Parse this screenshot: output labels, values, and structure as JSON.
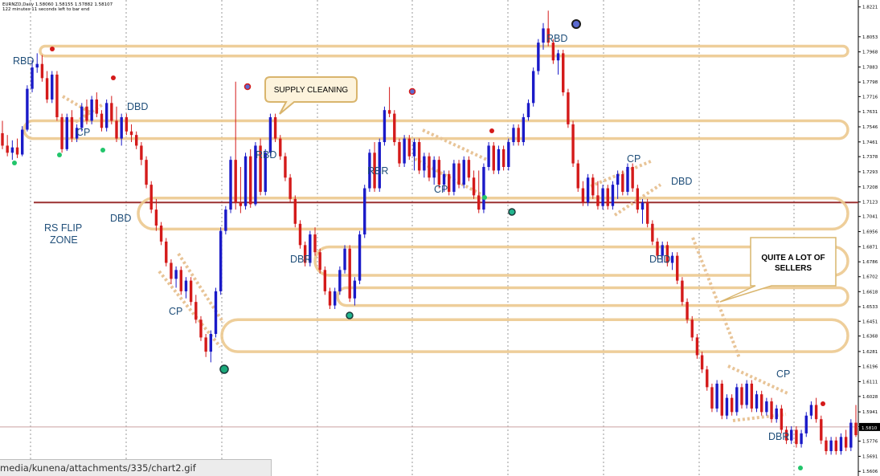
{
  "chart_data": {
    "type": "candlestick",
    "symbol_line": "EURNZD,Daily  1.58060 1.58155 1.57882 1.58107",
    "timer_line": "122 minutes 11 seconds left to bar end",
    "current_price_label": "1.5810",
    "y_ticks": [
      "1.8221",
      "1.8053",
      "1.7968",
      "1.7883",
      "1.7798",
      "1.7716",
      "1.7631",
      "1.7546",
      "1.7461",
      "1.7378",
      "1.7293",
      "1.7208",
      "1.7123",
      "1.7041",
      "1.6956",
      "1.6871",
      "1.6786",
      "1.6702",
      "1.6618",
      "1.6533",
      "1.6451",
      "1.6368",
      "1.6281",
      "1.6196",
      "1.6111",
      "1.6028",
      "1.5941",
      "1.5858",
      "1.5776",
      "1.5691",
      "1.5606"
    ],
    "ylim": [
      1.558,
      1.826
    ],
    "candles": [
      {
        "o": 1.751,
        "h": 1.758,
        "l": 1.742,
        "c": 1.744
      },
      {
        "o": 1.744,
        "h": 1.75,
        "l": 1.738,
        "c": 1.74
      },
      {
        "o": 1.74,
        "h": 1.747,
        "l": 1.736,
        "c": 1.743
      },
      {
        "o": 1.743,
        "h": 1.748,
        "l": 1.737,
        "c": 1.739
      },
      {
        "o": 1.739,
        "h": 1.755,
        "l": 1.738,
        "c": 1.753
      },
      {
        "o": 1.753,
        "h": 1.778,
        "l": 1.752,
        "c": 1.776
      },
      {
        "o": 1.776,
        "h": 1.792,
        "l": 1.774,
        "c": 1.788
      },
      {
        "o": 1.788,
        "h": 1.796,
        "l": 1.785,
        "c": 1.79
      },
      {
        "o": 1.79,
        "h": 1.795,
        "l": 1.78,
        "c": 1.782
      },
      {
        "o": 1.782,
        "h": 1.786,
        "l": 1.768,
        "c": 1.77
      },
      {
        "o": 1.77,
        "h": 1.786,
        "l": 1.768,
        "c": 1.784
      },
      {
        "o": 1.784,
        "h": 1.786,
        "l": 1.758,
        "c": 1.76
      },
      {
        "o": 1.76,
        "h": 1.762,
        "l": 1.74,
        "c": 1.742
      },
      {
        "o": 1.742,
        "h": 1.762,
        "l": 1.741,
        "c": 1.76
      },
      {
        "o": 1.76,
        "h": 1.764,
        "l": 1.746,
        "c": 1.748
      },
      {
        "o": 1.748,
        "h": 1.756,
        "l": 1.746,
        "c": 1.754
      },
      {
        "o": 1.754,
        "h": 1.768,
        "l": 1.752,
        "c": 1.766
      },
      {
        "o": 1.766,
        "h": 1.77,
        "l": 1.756,
        "c": 1.758
      },
      {
        "o": 1.758,
        "h": 1.772,
        "l": 1.756,
        "c": 1.77
      },
      {
        "o": 1.77,
        "h": 1.774,
        "l": 1.76,
        "c": 1.762
      },
      {
        "o": 1.762,
        "h": 1.764,
        "l": 1.752,
        "c": 1.754
      },
      {
        "o": 1.754,
        "h": 1.77,
        "l": 1.752,
        "c": 1.768
      },
      {
        "o": 1.768,
        "h": 1.772,
        "l": 1.756,
        "c": 1.758
      },
      {
        "o": 1.758,
        "h": 1.766,
        "l": 1.746,
        "c": 1.748
      },
      {
        "o": 1.748,
        "h": 1.762,
        "l": 1.744,
        "c": 1.76
      },
      {
        "o": 1.76,
        "h": 1.762,
        "l": 1.75,
        "c": 1.752
      },
      {
        "o": 1.752,
        "h": 1.756,
        "l": 1.746,
        "c": 1.75
      },
      {
        "o": 1.75,
        "h": 1.752,
        "l": 1.742,
        "c": 1.744
      },
      {
        "o": 1.744,
        "h": 1.746,
        "l": 1.733,
        "c": 1.736
      },
      {
        "o": 1.736,
        "h": 1.738,
        "l": 1.72,
        "c": 1.722
      },
      {
        "o": 1.722,
        "h": 1.724,
        "l": 1.706,
        "c": 1.708
      },
      {
        "o": 1.708,
        "h": 1.714,
        "l": 1.696,
        "c": 1.699
      },
      {
        "o": 1.699,
        "h": 1.701,
        "l": 1.688,
        "c": 1.69
      },
      {
        "o": 1.69,
        "h": 1.692,
        "l": 1.676,
        "c": 1.678
      },
      {
        "o": 1.678,
        "h": 1.68,
        "l": 1.666,
        "c": 1.669
      },
      {
        "o": 1.669,
        "h": 1.676,
        "l": 1.664,
        "c": 1.674
      },
      {
        "o": 1.674,
        "h": 1.676,
        "l": 1.66,
        "c": 1.662
      },
      {
        "o": 1.662,
        "h": 1.67,
        "l": 1.658,
        "c": 1.668
      },
      {
        "o": 1.668,
        "h": 1.67,
        "l": 1.654,
        "c": 1.656
      },
      {
        "o": 1.656,
        "h": 1.66,
        "l": 1.644,
        "c": 1.646
      },
      {
        "o": 1.646,
        "h": 1.648,
        "l": 1.634,
        "c": 1.636
      },
      {
        "o": 1.636,
        "h": 1.638,
        "l": 1.625,
        "c": 1.628
      },
      {
        "o": 1.628,
        "h": 1.64,
        "l": 1.622,
        "c": 1.638
      },
      {
        "o": 1.638,
        "h": 1.664,
        "l": 1.636,
        "c": 1.662
      },
      {
        "o": 1.662,
        "h": 1.698,
        "l": 1.66,
        "c": 1.696
      },
      {
        "o": 1.696,
        "h": 1.71,
        "l": 1.694,
        "c": 1.708
      },
      {
        "o": 1.708,
        "h": 1.738,
        "l": 1.706,
        "c": 1.736
      },
      {
        "o": 1.736,
        "h": 1.78,
        "l": 1.708,
        "c": 1.712
      },
      {
        "o": 1.712,
        "h": 1.732,
        "l": 1.706,
        "c": 1.71
      },
      {
        "o": 1.71,
        "h": 1.74,
        "l": 1.708,
        "c": 1.738
      },
      {
        "o": 1.738,
        "h": 1.742,
        "l": 1.709,
        "c": 1.711
      },
      {
        "o": 1.711,
        "h": 1.746,
        "l": 1.71,
        "c": 1.744
      },
      {
        "o": 1.744,
        "h": 1.748,
        "l": 1.716,
        "c": 1.718
      },
      {
        "o": 1.718,
        "h": 1.742,
        "l": 1.716,
        "c": 1.74
      },
      {
        "o": 1.74,
        "h": 1.762,
        "l": 1.738,
        "c": 1.76
      },
      {
        "o": 1.76,
        "h": 1.762,
        "l": 1.746,
        "c": 1.748
      },
      {
        "o": 1.748,
        "h": 1.75,
        "l": 1.736,
        "c": 1.738
      },
      {
        "o": 1.738,
        "h": 1.74,
        "l": 1.724,
        "c": 1.726
      },
      {
        "o": 1.726,
        "h": 1.728,
        "l": 1.712,
        "c": 1.714
      },
      {
        "o": 1.714,
        "h": 1.716,
        "l": 1.698,
        "c": 1.7
      },
      {
        "o": 1.7,
        "h": 1.702,
        "l": 1.686,
        "c": 1.688
      },
      {
        "o": 1.688,
        "h": 1.69,
        "l": 1.676,
        "c": 1.678
      },
      {
        "o": 1.678,
        "h": 1.696,
        "l": 1.676,
        "c": 1.694
      },
      {
        "o": 1.694,
        "h": 1.698,
        "l": 1.682,
        "c": 1.684
      },
      {
        "o": 1.684,
        "h": 1.686,
        "l": 1.672,
        "c": 1.674
      },
      {
        "o": 1.674,
        "h": 1.676,
        "l": 1.66,
        "c": 1.662
      },
      {
        "o": 1.662,
        "h": 1.664,
        "l": 1.652,
        "c": 1.654
      },
      {
        "o": 1.654,
        "h": 1.664,
        "l": 1.652,
        "c": 1.662
      },
      {
        "o": 1.662,
        "h": 1.676,
        "l": 1.66,
        "c": 1.674
      },
      {
        "o": 1.674,
        "h": 1.688,
        "l": 1.672,
        "c": 1.686
      },
      {
        "o": 1.686,
        "h": 1.688,
        "l": 1.656,
        "c": 1.658
      },
      {
        "o": 1.658,
        "h": 1.67,
        "l": 1.654,
        "c": 1.668
      },
      {
        "o": 1.668,
        "h": 1.696,
        "l": 1.666,
        "c": 1.694
      },
      {
        "o": 1.694,
        "h": 1.722,
        "l": 1.692,
        "c": 1.72
      },
      {
        "o": 1.72,
        "h": 1.742,
        "l": 1.718,
        "c": 1.74
      },
      {
        "o": 1.74,
        "h": 1.746,
        "l": 1.718,
        "c": 1.72
      },
      {
        "o": 1.72,
        "h": 1.748,
        "l": 1.718,
        "c": 1.746
      },
      {
        "o": 1.746,
        "h": 1.766,
        "l": 1.744,
        "c": 1.764
      },
      {
        "o": 1.764,
        "h": 1.777,
        "l": 1.76,
        "c": 1.762
      },
      {
        "o": 1.762,
        "h": 1.764,
        "l": 1.744,
        "c": 1.746
      },
      {
        "o": 1.746,
        "h": 1.748,
        "l": 1.732,
        "c": 1.734
      },
      {
        "o": 1.734,
        "h": 1.75,
        "l": 1.732,
        "c": 1.748
      },
      {
        "o": 1.748,
        "h": 1.75,
        "l": 1.736,
        "c": 1.738
      },
      {
        "o": 1.738,
        "h": 1.748,
        "l": 1.73,
        "c": 1.746
      },
      {
        "o": 1.746,
        "h": 1.748,
        "l": 1.728,
        "c": 1.73
      },
      {
        "o": 1.73,
        "h": 1.74,
        "l": 1.726,
        "c": 1.738
      },
      {
        "o": 1.738,
        "h": 1.74,
        "l": 1.724,
        "c": 1.726
      },
      {
        "o": 1.726,
        "h": 1.738,
        "l": 1.722,
        "c": 1.736
      },
      {
        "o": 1.736,
        "h": 1.738,
        "l": 1.72,
        "c": 1.722
      },
      {
        "o": 1.722,
        "h": 1.73,
        "l": 1.718,
        "c": 1.728
      },
      {
        "o": 1.728,
        "h": 1.73,
        "l": 1.716,
        "c": 1.718
      },
      {
        "o": 1.718,
        "h": 1.736,
        "l": 1.716,
        "c": 1.734
      },
      {
        "o": 1.734,
        "h": 1.736,
        "l": 1.72,
        "c": 1.722
      },
      {
        "o": 1.722,
        "h": 1.738,
        "l": 1.72,
        "c": 1.736
      },
      {
        "o": 1.736,
        "h": 1.738,
        "l": 1.724,
        "c": 1.726
      },
      {
        "o": 1.726,
        "h": 1.73,
        "l": 1.714,
        "c": 1.716
      },
      {
        "o": 1.716,
        "h": 1.73,
        "l": 1.706,
        "c": 1.708
      },
      {
        "o": 1.708,
        "h": 1.734,
        "l": 1.706,
        "c": 1.732
      },
      {
        "o": 1.732,
        "h": 1.746,
        "l": 1.73,
        "c": 1.744
      },
      {
        "o": 1.744,
        "h": 1.746,
        "l": 1.728,
        "c": 1.73
      },
      {
        "o": 1.73,
        "h": 1.744,
        "l": 1.728,
        "c": 1.742
      },
      {
        "o": 1.742,
        "h": 1.744,
        "l": 1.73,
        "c": 1.732
      },
      {
        "o": 1.732,
        "h": 1.748,
        "l": 1.73,
        "c": 1.746
      },
      {
        "o": 1.746,
        "h": 1.756,
        "l": 1.744,
        "c": 1.754
      },
      {
        "o": 1.754,
        "h": 1.756,
        "l": 1.744,
        "c": 1.746
      },
      {
        "o": 1.746,
        "h": 1.762,
        "l": 1.744,
        "c": 1.76
      },
      {
        "o": 1.76,
        "h": 1.77,
        "l": 1.758,
        "c": 1.768
      },
      {
        "o": 1.768,
        "h": 1.788,
        "l": 1.766,
        "c": 1.786
      },
      {
        "o": 1.786,
        "h": 1.804,
        "l": 1.784,
        "c": 1.802
      },
      {
        "o": 1.802,
        "h": 1.813,
        "l": 1.798,
        "c": 1.81
      },
      {
        "o": 1.81,
        "h": 1.82,
        "l": 1.8,
        "c": 1.802
      },
      {
        "o": 1.802,
        "h": 1.804,
        "l": 1.79,
        "c": 1.792
      },
      {
        "o": 1.792,
        "h": 1.798,
        "l": 1.784,
        "c": 1.796
      },
      {
        "o": 1.796,
        "h": 1.798,
        "l": 1.772,
        "c": 1.774
      },
      {
        "o": 1.774,
        "h": 1.776,
        "l": 1.754,
        "c": 1.756
      },
      {
        "o": 1.756,
        "h": 1.758,
        "l": 1.732,
        "c": 1.734
      },
      {
        "o": 1.734,
        "h": 1.736,
        "l": 1.718,
        "c": 1.72
      },
      {
        "o": 1.72,
        "h": 1.724,
        "l": 1.71,
        "c": 1.712
      },
      {
        "o": 1.712,
        "h": 1.728,
        "l": 1.71,
        "c": 1.726
      },
      {
        "o": 1.726,
        "h": 1.728,
        "l": 1.714,
        "c": 1.716
      },
      {
        "o": 1.716,
        "h": 1.724,
        "l": 1.708,
        "c": 1.71
      },
      {
        "o": 1.71,
        "h": 1.722,
        "l": 1.708,
        "c": 1.72
      },
      {
        "o": 1.72,
        "h": 1.722,
        "l": 1.708,
        "c": 1.71
      },
      {
        "o": 1.71,
        "h": 1.724,
        "l": 1.708,
        "c": 1.722
      },
      {
        "o": 1.722,
        "h": 1.73,
        "l": 1.714,
        "c": 1.728
      },
      {
        "o": 1.728,
        "h": 1.73,
        "l": 1.716,
        "c": 1.718
      },
      {
        "o": 1.718,
        "h": 1.734,
        "l": 1.716,
        "c": 1.732
      },
      {
        "o": 1.732,
        "h": 1.734,
        "l": 1.718,
        "c": 1.72
      },
      {
        "o": 1.72,
        "h": 1.722,
        "l": 1.706,
        "c": 1.708
      },
      {
        "o": 1.708,
        "h": 1.714,
        "l": 1.7,
        "c": 1.712
      },
      {
        "o": 1.712,
        "h": 1.714,
        "l": 1.698,
        "c": 1.7
      },
      {
        "o": 1.7,
        "h": 1.702,
        "l": 1.688,
        "c": 1.69
      },
      {
        "o": 1.69,
        "h": 1.692,
        "l": 1.68,
        "c": 1.682
      },
      {
        "o": 1.682,
        "h": 1.69,
        "l": 1.678,
        "c": 1.688
      },
      {
        "o": 1.688,
        "h": 1.69,
        "l": 1.676,
        "c": 1.678
      },
      {
        "o": 1.678,
        "h": 1.684,
        "l": 1.674,
        "c": 1.682
      },
      {
        "o": 1.682,
        "h": 1.684,
        "l": 1.666,
        "c": 1.668
      },
      {
        "o": 1.668,
        "h": 1.67,
        "l": 1.654,
        "c": 1.656
      },
      {
        "o": 1.656,
        "h": 1.658,
        "l": 1.644,
        "c": 1.646
      },
      {
        "o": 1.646,
        "h": 1.648,
        "l": 1.634,
        "c": 1.636
      },
      {
        "o": 1.636,
        "h": 1.638,
        "l": 1.624,
        "c": 1.626
      },
      {
        "o": 1.626,
        "h": 1.628,
        "l": 1.616,
        "c": 1.618
      },
      {
        "o": 1.618,
        "h": 1.62,
        "l": 1.606,
        "c": 1.608
      },
      {
        "o": 1.608,
        "h": 1.61,
        "l": 1.594,
        "c": 1.596
      },
      {
        "o": 1.596,
        "h": 1.612,
        "l": 1.594,
        "c": 1.61
      },
      {
        "o": 1.61,
        "h": 1.612,
        "l": 1.59,
        "c": 1.592
      },
      {
        "o": 1.592,
        "h": 1.604,
        "l": 1.59,
        "c": 1.602
      },
      {
        "o": 1.602,
        "h": 1.604,
        "l": 1.592,
        "c": 1.594
      },
      {
        "o": 1.594,
        "h": 1.61,
        "l": 1.592,
        "c": 1.608
      },
      {
        "o": 1.608,
        "h": 1.61,
        "l": 1.596,
        "c": 1.598
      },
      {
        "o": 1.598,
        "h": 1.612,
        "l": 1.596,
        "c": 1.61
      },
      {
        "o": 1.61,
        "h": 1.612,
        "l": 1.594,
        "c": 1.596
      },
      {
        "o": 1.596,
        "h": 1.606,
        "l": 1.594,
        "c": 1.604
      },
      {
        "o": 1.604,
        "h": 1.606,
        "l": 1.592,
        "c": 1.594
      },
      {
        "o": 1.594,
        "h": 1.602,
        "l": 1.592,
        "c": 1.6
      },
      {
        "o": 1.6,
        "h": 1.602,
        "l": 1.588,
        "c": 1.59
      },
      {
        "o": 1.59,
        "h": 1.598,
        "l": 1.588,
        "c": 1.596
      },
      {
        "o": 1.596,
        "h": 1.598,
        "l": 1.582,
        "c": 1.584
      },
      {
        "o": 1.584,
        "h": 1.586,
        "l": 1.576,
        "c": 1.578
      },
      {
        "o": 1.578,
        "h": 1.586,
        "l": 1.576,
        "c": 1.584
      },
      {
        "o": 1.584,
        "h": 1.586,
        "l": 1.574,
        "c": 1.576
      },
      {
        "o": 1.576,
        "h": 1.584,
        "l": 1.574,
        "c": 1.582
      },
      {
        "o": 1.582,
        "h": 1.594,
        "l": 1.58,
        "c": 1.592
      },
      {
        "o": 1.592,
        "h": 1.6,
        "l": 1.59,
        "c": 1.598
      },
      {
        "o": 1.598,
        "h": 1.602,
        "l": 1.588,
        "c": 1.59
      },
      {
        "o": 1.59,
        "h": 1.592,
        "l": 1.576,
        "c": 1.578
      },
      {
        "o": 1.578,
        "h": 1.58,
        "l": 1.57,
        "c": 1.572
      },
      {
        "o": 1.572,
        "h": 1.58,
        "l": 1.57,
        "c": 1.578
      },
      {
        "o": 1.578,
        "h": 1.58,
        "l": 1.57,
        "c": 1.572
      },
      {
        "o": 1.572,
        "h": 1.582,
        "l": 1.57,
        "c": 1.58
      },
      {
        "o": 1.58,
        "h": 1.584,
        "l": 1.572,
        "c": 1.574
      },
      {
        "o": 1.574,
        "h": 1.59,
        "l": 1.572,
        "c": 1.588
      },
      {
        "o": 1.588,
        "h": 1.598,
        "l": 1.58,
        "c": 1.581
      }
    ],
    "annotations": [
      {
        "text": "RBD"
      },
      {
        "text": "CP"
      },
      {
        "text": "DBD"
      },
      {
        "text": "DBD"
      },
      {
        "text": "RS FLIP"
      },
      {
        "text": "ZONE"
      },
      {
        "text": "CP"
      },
      {
        "text": "RBD"
      },
      {
        "text": "DBR"
      },
      {
        "text": "RBR"
      },
      {
        "text": "CP"
      },
      {
        "text": "RBD"
      },
      {
        "text": "CP"
      },
      {
        "text": "DBD"
      },
      {
        "text": "DBD"
      },
      {
        "text": "CP"
      },
      {
        "text": "DBR"
      }
    ],
    "callouts": [
      {
        "lines": [
          "SUPPLY CLEANING"
        ]
      },
      {
        "lines": [
          "QUITE A LOT OF",
          "SELLERS"
        ]
      }
    ],
    "zones": [
      {
        "from": 1.7945,
        "to": 1.8
      },
      {
        "from": 1.748,
        "to": 1.758
      },
      {
        "from": 1.697,
        "to": 1.7145
      },
      {
        "from": 1.671,
        "to": 1.687
      },
      {
        "from": 1.654,
        "to": 1.664
      },
      {
        "from": 1.628,
        "to": 1.646
      }
    ],
    "horizontal_lines": [
      {
        "price": 1.712,
        "color": "#9b3030"
      },
      {
        "price": 1.5856,
        "color": "#c9a0a0"
      }
    ],
    "colors": {
      "bull": "#1a1ac8",
      "bear": "#d41a1a",
      "zone": "#ecc98f",
      "trend": "#e8c497",
      "grid": "#9a9a9a"
    }
  },
  "status_bar": {
    "url": "media/kunena/attachments/335/chart2.gif"
  }
}
